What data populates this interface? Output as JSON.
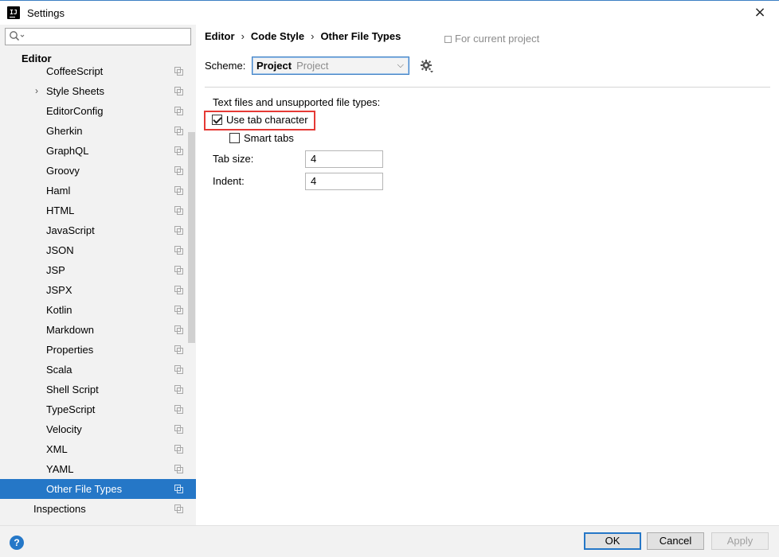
{
  "window": {
    "icon_text": "IJ",
    "title": "Settings"
  },
  "sidebar": {
    "search_placeholder": "",
    "group_label": "Editor",
    "items": [
      {
        "label": "CoffeeScript"
      },
      {
        "label": "Style Sheets",
        "expandable": true
      },
      {
        "label": "EditorConfig"
      },
      {
        "label": "Gherkin"
      },
      {
        "label": "GraphQL"
      },
      {
        "label": "Groovy"
      },
      {
        "label": "Haml"
      },
      {
        "label": "HTML"
      },
      {
        "label": "JavaScript"
      },
      {
        "label": "JSON"
      },
      {
        "label": "JSP"
      },
      {
        "label": "JSPX"
      },
      {
        "label": "Kotlin"
      },
      {
        "label": "Markdown"
      },
      {
        "label": "Properties"
      },
      {
        "label": "Scala"
      },
      {
        "label": "Shell Script"
      },
      {
        "label": "TypeScript"
      },
      {
        "label": "Velocity"
      },
      {
        "label": "XML"
      },
      {
        "label": "YAML"
      },
      {
        "label": "Other File Types",
        "selected": true
      }
    ],
    "inspections_label": "Inspections"
  },
  "breadcrumb": {
    "part1": "Editor",
    "part2": "Code Style",
    "part3": "Other File Types",
    "separator": "›"
  },
  "scope_note": "For current project",
  "scheme": {
    "label": "Scheme:",
    "value_main": "Project",
    "value_sub": "Project"
  },
  "settings": {
    "section_label": "Text files and unsupported file types:",
    "use_tab_label": "Use tab character",
    "use_tab_checked": true,
    "smart_tabs_label": "Smart tabs",
    "smart_tabs_checked": false,
    "tab_size_label": "Tab size:",
    "tab_size_value": "4",
    "indent_label": "Indent:",
    "indent_value": "4"
  },
  "buttons": {
    "help": "?",
    "ok": "OK",
    "cancel": "Cancel",
    "apply": "Apply"
  },
  "colors": {
    "selection": "#2577c7",
    "highlight": "#e53935"
  },
  "icons": {
    "close": "×",
    "dropdown": "⌵"
  }
}
